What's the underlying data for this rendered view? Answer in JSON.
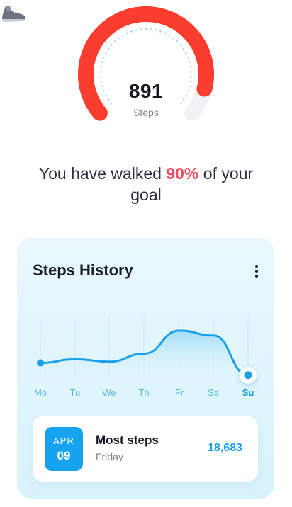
{
  "gauge": {
    "steps_value": "891",
    "steps_label": "Steps",
    "progress": 0.9,
    "progress_color": "#fa3d2f",
    "track_color": "#f1f2f5",
    "dot_color": "#a9d8f2",
    "icon": "sneaker-icon"
  },
  "summary": {
    "prefix": "You have walked ",
    "percent": "90%",
    "suffix": " of your goal"
  },
  "history": {
    "title": "Steps History",
    "menu_icon": "more-vertical-icon",
    "accent_color": "#1aa0e8",
    "days": [
      "Mo",
      "Tu",
      "We",
      "Th",
      "Fr",
      "Sa",
      "Su"
    ],
    "active_day": "Su",
    "relative_values": [
      0.25,
      0.31,
      0.27,
      0.4,
      0.78,
      0.7,
      0.05
    ]
  },
  "most_steps": {
    "month": "APR",
    "day": "09",
    "title": "Most steps",
    "weekday": "Friday",
    "value": "18,683"
  }
}
